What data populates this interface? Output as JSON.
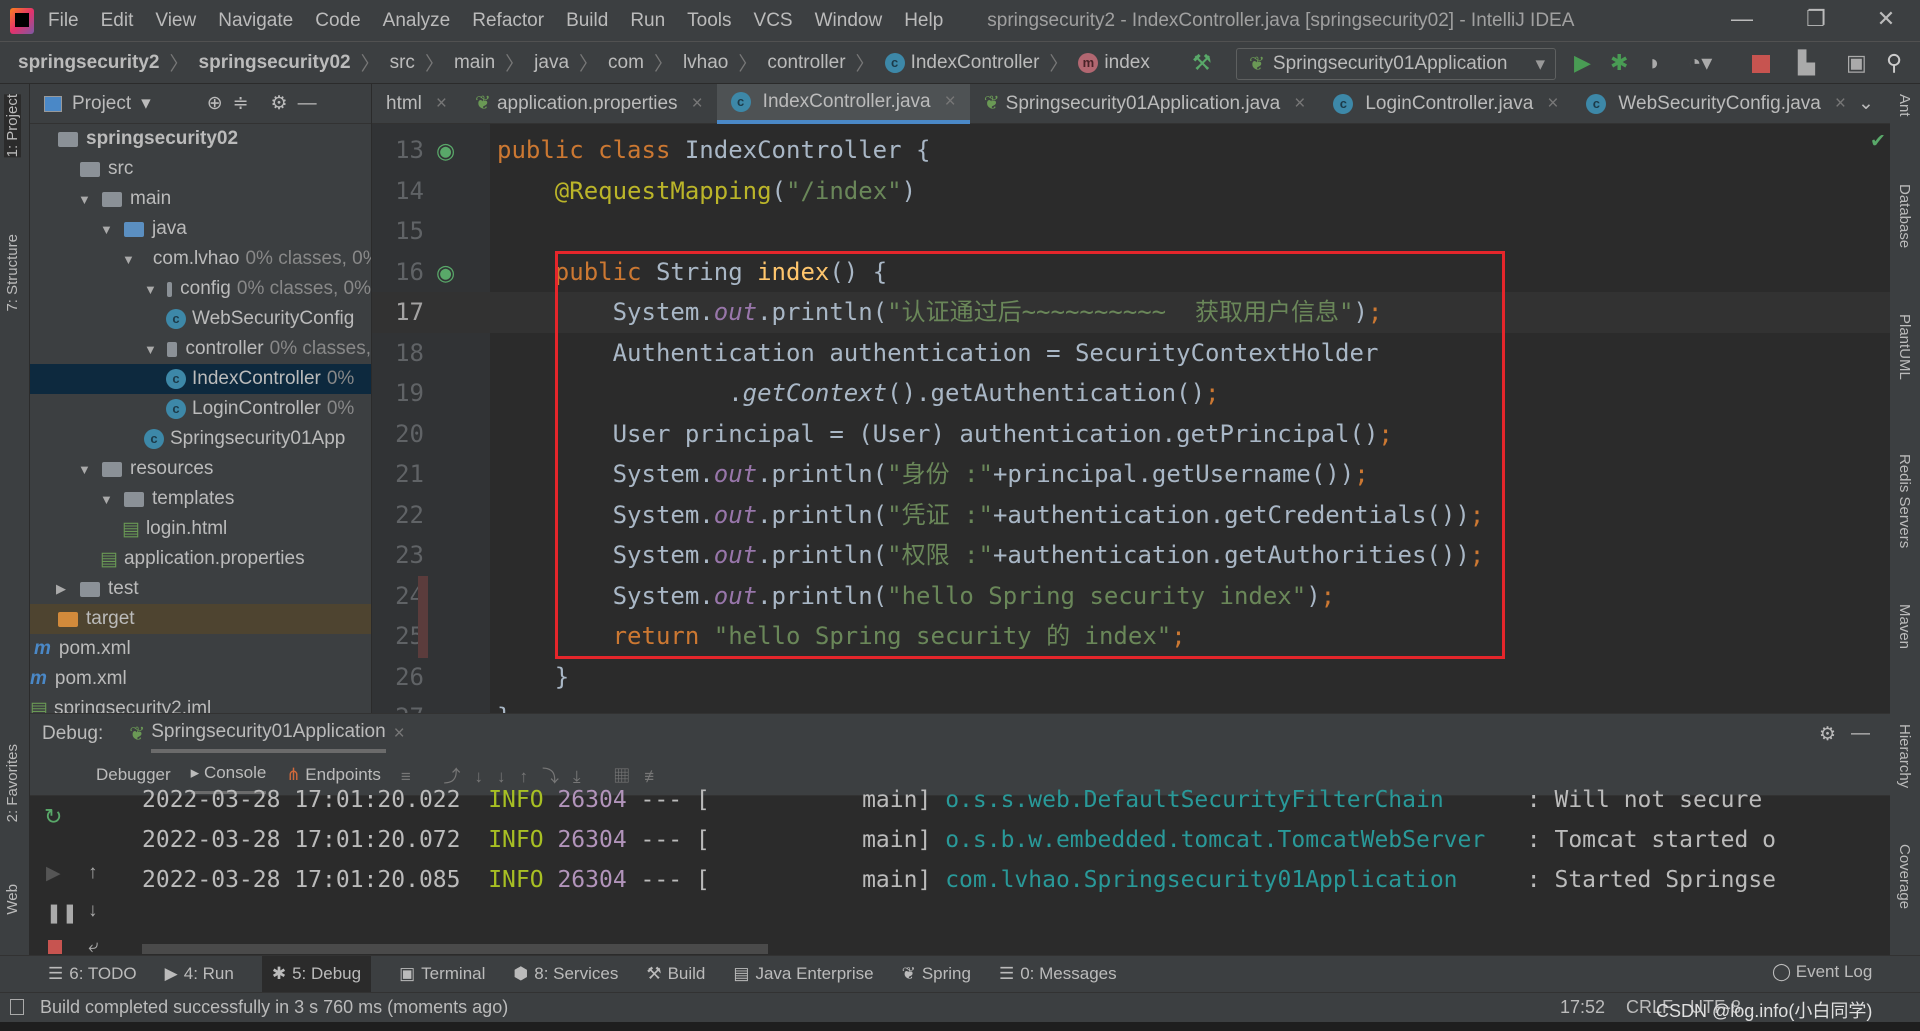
{
  "window": {
    "title": "springsecurity2 - IndexController.java [springsecurity02] - IntelliJ IDEA",
    "minimize": "—",
    "maximize": "❐",
    "close": "✕"
  },
  "menu": [
    "File",
    "Edit",
    "View",
    "Navigate",
    "Code",
    "Analyze",
    "Refactor",
    "Build",
    "Run",
    "Tools",
    "VCS",
    "Window",
    "Help"
  ],
  "breadcrumb": [
    "springsecurity2",
    "springsecurity02",
    "src",
    "main",
    "java",
    "com",
    "lvhao",
    "controller",
    "IndexController",
    "index"
  ],
  "run_config": {
    "label": "Springsecurity01Application"
  },
  "project": {
    "title": "Project",
    "tree": [
      {
        "label": "springsecurity02",
        "depth": 0,
        "kind": "module",
        "bold": true
      },
      {
        "label": "src",
        "depth": 1,
        "kind": "folder"
      },
      {
        "label": "main",
        "depth": 2,
        "kind": "folder",
        "open": true
      },
      {
        "label": "java",
        "depth": 3,
        "kind": "folder-blue",
        "open": true
      },
      {
        "label": "com.lvhao",
        "extra": "0% classes, 0%",
        "depth": 4,
        "kind": "folder",
        "open": true
      },
      {
        "label": "config",
        "extra": "0% classes, 0%",
        "depth": 5,
        "kind": "folder",
        "open": true
      },
      {
        "label": "WebSecurityConfig",
        "depth": 6,
        "kind": "class"
      },
      {
        "label": "controller",
        "extra": "0% classes,",
        "depth": 5,
        "kind": "folder",
        "open": true
      },
      {
        "label": "IndexController",
        "extra": "0%",
        "depth": 6,
        "kind": "class",
        "selected": true
      },
      {
        "label": "LoginController",
        "extra": "0%",
        "depth": 6,
        "kind": "class"
      },
      {
        "label": "Springsecurity01App",
        "depth": 5,
        "kind": "class"
      },
      {
        "label": "resources",
        "depth": 2,
        "kind": "folder",
        "open": true
      },
      {
        "label": "templates",
        "depth": 3,
        "kind": "folder",
        "open": true
      },
      {
        "label": "login.html",
        "depth": 4,
        "kind": "file"
      },
      {
        "label": "application.properties",
        "depth": 3,
        "kind": "file"
      },
      {
        "label": "test",
        "depth": 1,
        "kind": "folder",
        "closed": true
      },
      {
        "label": "target",
        "depth": 0,
        "kind": "folder-orange",
        "target": true
      },
      {
        "label": "pom.xml",
        "depth": 0,
        "kind": "maven"
      },
      {
        "label": "pom.xml",
        "depth": -1,
        "kind": "maven"
      },
      {
        "label": "springsecurity2.iml",
        "depth": -1,
        "kind": "file"
      }
    ]
  },
  "tabs": [
    {
      "label": "html",
      "active": false
    },
    {
      "label": "application.properties",
      "active": false
    },
    {
      "label": "IndexController.java",
      "active": true
    },
    {
      "label": "Springsecurity01Application.java",
      "active": false
    },
    {
      "label": "LoginController.java",
      "active": false
    },
    {
      "label": "WebSecurityConfig.java",
      "active": false
    }
  ],
  "code": [
    {
      "n": "13",
      "t": [
        [
          "kw",
          "public class "
        ],
        [
          "df",
          "IndexController {"
        ]
      ]
    },
    {
      "n": "14",
      "t": [
        [
          "df",
          "    "
        ],
        [
          "an",
          "@RequestMapping"
        ],
        [
          "df",
          "("
        ],
        [
          "st",
          "\"/index\""
        ],
        [
          "df",
          ")"
        ]
      ]
    },
    {
      "n": "15",
      "t": []
    },
    {
      "n": "16",
      "t": [
        [
          "df",
          "    "
        ],
        [
          "kw",
          "public "
        ],
        [
          "df",
          "String "
        ],
        [
          "fn",
          "index"
        ],
        [
          "df",
          "() {"
        ]
      ]
    },
    {
      "n": "17",
      "cur": true,
      "t": [
        [
          "df",
          "        System."
        ],
        [
          "fld",
          "out"
        ],
        [
          "df",
          ".println("
        ],
        [
          "st",
          "\"认证通过后~~~~~~~~~~  获取用户信息\""
        ],
        [
          "df",
          ")"
        ],
        [
          "kw",
          ";"
        ]
      ]
    },
    {
      "n": "18",
      "t": [
        [
          "df",
          "        Authentication authentication = SecurityContextHolder"
        ]
      ]
    },
    {
      "n": "19",
      "t": [
        [
          "df",
          "                ."
        ],
        [
          "it",
          "getContext"
        ],
        [
          "df",
          "().getAuthentication()"
        ],
        [
          "kw",
          ";"
        ]
      ]
    },
    {
      "n": "20",
      "t": [
        [
          "df",
          "        User principal = (User) authentication.getPrincipal()"
        ],
        [
          "kw",
          ";"
        ]
      ]
    },
    {
      "n": "21",
      "t": [
        [
          "df",
          "        System."
        ],
        [
          "fld",
          "out"
        ],
        [
          "df",
          ".println("
        ],
        [
          "st",
          "\"身份 :\""
        ],
        [
          "df",
          "+principal.getUsername())"
        ],
        [
          "kw",
          ";"
        ]
      ]
    },
    {
      "n": "22",
      "t": [
        [
          "df",
          "        System."
        ],
        [
          "fld",
          "out"
        ],
        [
          "df",
          ".println("
        ],
        [
          "st",
          "\"凭证 :\""
        ],
        [
          "df",
          "+authentication.getCredentials())"
        ],
        [
          "kw",
          ";"
        ]
      ]
    },
    {
      "n": "23",
      "t": [
        [
          "df",
          "        System."
        ],
        [
          "fld",
          "out"
        ],
        [
          "df",
          ".println("
        ],
        [
          "st",
          "\"权限 :\""
        ],
        [
          "df",
          "+authentication.getAuthorities())"
        ],
        [
          "kw",
          ";"
        ]
      ]
    },
    {
      "n": "24",
      "t": [
        [
          "df",
          "        System."
        ],
        [
          "fld",
          "out"
        ],
        [
          "df",
          ".println("
        ],
        [
          "st",
          "\"hello Spring security index\""
        ],
        [
          "df",
          ")"
        ],
        [
          "kw",
          ";"
        ]
      ]
    },
    {
      "n": "25",
      "t": [
        [
          "kw",
          "        return "
        ],
        [
          "st",
          "\"hello Spring security 的 index\""
        ],
        [
          "kw",
          ";"
        ]
      ]
    },
    {
      "n": "26",
      "t": [
        [
          "df",
          "    }"
        ]
      ]
    },
    {
      "n": "27",
      "t": [
        [
          "df",
          "}"
        ]
      ]
    }
  ],
  "debug": {
    "label": "Debug:",
    "session": "Springsecurity01Application",
    "tabs": [
      "Debugger",
      "Console",
      "Endpoints"
    ],
    "console": [
      [
        [
          "c-def",
          "2022-03-28 17:01:20.022  "
        ],
        [
          "c-info",
          "INFO "
        ],
        [
          "c-pid",
          "26304"
        ],
        [
          "c-def",
          " --- [           main] "
        ],
        [
          "c-cls",
          "o.s.s.web.DefaultSecurityFilterChain    "
        ],
        [
          "c-def",
          "  : Will not secure"
        ]
      ],
      [
        [
          "c-def",
          "2022-03-28 17:01:20.072  "
        ],
        [
          "c-info",
          "INFO "
        ],
        [
          "c-pid",
          "26304"
        ],
        [
          "c-def",
          " --- [           main] "
        ],
        [
          "c-cls",
          "o.s.b.w.embedded.tomcat.TomcatWebServer "
        ],
        [
          "c-def",
          "  : Tomcat started o"
        ]
      ],
      [
        [
          "c-def",
          "2022-03-28 17:01:20.085  "
        ],
        [
          "c-info",
          "INFO "
        ],
        [
          "c-pid",
          "26304"
        ],
        [
          "c-def",
          " --- [           main] "
        ],
        [
          "c-cls",
          "com.lvhao.Springsecurity01Application   "
        ],
        [
          "c-def",
          "  : Started Springse"
        ]
      ]
    ]
  },
  "bottom_tabs": [
    {
      "label": "6: TODO",
      "icon": "☰"
    },
    {
      "label": "4: Run",
      "icon": "▶"
    },
    {
      "label": "5: Debug",
      "icon": "✱",
      "active": true
    },
    {
      "label": "Terminal",
      "icon": "▣"
    },
    {
      "label": "8: Services",
      "icon": "⬢"
    },
    {
      "label": "Build",
      "icon": "⚒"
    },
    {
      "label": "Java Enterprise",
      "icon": "▤"
    },
    {
      "label": "Spring",
      "icon": "❦"
    },
    {
      "label": "0: Messages",
      "icon": "☰"
    }
  ],
  "event_log": "Event Log",
  "status": {
    "message": "Build completed successfully in 3 s 760 ms (moments ago)",
    "time": "17:52",
    "line_sep": "CRLF",
    "encoding": "UTF-8",
    "watermark": "CSDN @log.info(小白同学)"
  },
  "side_tools": {
    "left": [
      "1: Project",
      "7: Structure",
      "2: Favorites",
      "Web"
    ],
    "right": [
      "Ant",
      "Database",
      "PlantUML",
      "Redis Servers",
      "Maven",
      "Hierarchy",
      "Coverage"
    ]
  },
  "colors": {
    "keyword": "#cc7832",
    "string": "#6a8759",
    "annotation": "#bbb529",
    "field": "#9876aa",
    "method": "#ffc66d",
    "highlight_box": "#e5262b"
  }
}
